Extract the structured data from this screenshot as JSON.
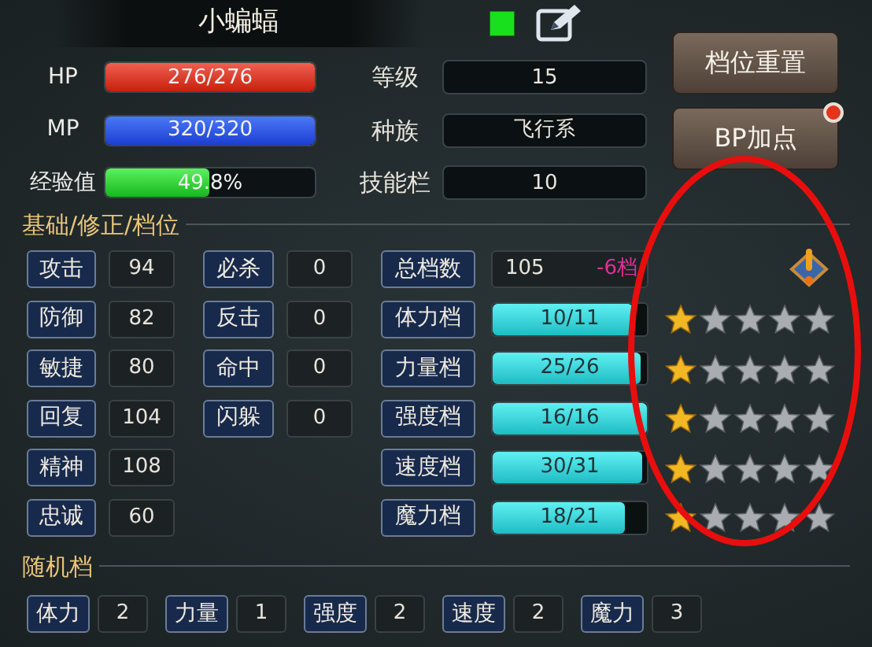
{
  "name": "小蝙蝠",
  "vitals": [
    {
      "kind": "hp",
      "label": "HP",
      "reading": "276/276",
      "level": 1
    },
    {
      "kind": "mp",
      "label": "MP",
      "reading": "320/320",
      "level": 1
    },
    {
      "kind": "exp",
      "label": "经验值",
      "reading": "49.8%",
      "level": 0.498
    }
  ],
  "info": [
    {
      "label": "等级",
      "value": "15"
    },
    {
      "label": "种族",
      "value": "飞行系"
    },
    {
      "label": "技能栏",
      "value": "10"
    }
  ],
  "buttons": [
    {
      "label": "档位重置",
      "notification": false
    },
    {
      "label": "BP加点",
      "notification": true
    }
  ],
  "base_section": {
    "title": "基础/修正/档位",
    "stats": [
      {
        "label": "攻击",
        "value": "94"
      },
      {
        "label": "防御",
        "value": "82"
      },
      {
        "label": "敏捷",
        "value": "80"
      },
      {
        "label": "回复",
        "value": "104"
      },
      {
        "label": "精神",
        "value": "108"
      },
      {
        "label": "忠诚",
        "value": "60"
      }
    ],
    "modifiers": [
      {
        "label": "必杀",
        "value": "0"
      },
      {
        "label": "反击",
        "value": "0"
      },
      {
        "label": "命中",
        "value": "0"
      },
      {
        "label": "闪躲",
        "value": "0"
      }
    ],
    "total": {
      "label": "总档数",
      "value": "105",
      "delta": "-6档"
    },
    "grades": [
      {
        "label": "体力档",
        "reading": "10/11",
        "level": 0.91,
        "stars": 1
      },
      {
        "label": "力量档",
        "reading": "25/26",
        "level": 0.96,
        "stars": 1
      },
      {
        "label": "强度档",
        "reading": "16/16",
        "level": 1,
        "stars": 1
      },
      {
        "label": "速度档",
        "reading": "30/31",
        "level": 0.97,
        "stars": 1
      },
      {
        "label": "魔力档",
        "reading": "18/21",
        "level": 0.86,
        "stars": 1
      }
    ]
  },
  "random_section": {
    "title": "随机档",
    "items": [
      {
        "label": "体力",
        "value": "2"
      },
      {
        "label": "力量",
        "value": "1"
      },
      {
        "label": "强度",
        "value": "2"
      },
      {
        "label": "速度",
        "value": "2"
      },
      {
        "label": "魔力",
        "value": "3"
      }
    ]
  }
}
